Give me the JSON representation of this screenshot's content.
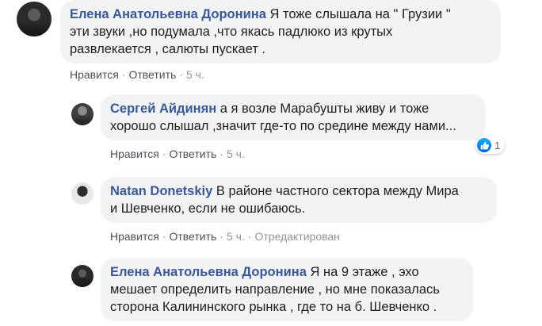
{
  "comments": [
    {
      "author": "Елена Анатольевна Доронина",
      "lines": [
        "Я тоже слышала на \" Грузии \"",
        "эти звуки ,но подумала ,что якась падлюко из крутых",
        "развлекается , салюты пускает ."
      ],
      "like_label": "Нравится",
      "reply_label": "Ответить",
      "time": "5 ч."
    },
    {
      "author": "Сергей Айдинян",
      "lines": [
        "а я возле Марабушты живу и тоже",
        "хорошо слышал ,значит где-то по средине между нами..."
      ],
      "like_label": "Нравится",
      "reply_label": "Ответить",
      "time": "5 ч.",
      "reaction_icon": "like-icon",
      "reaction_count": "1"
    },
    {
      "author": "Natan Donetskiy",
      "lines": [
        "В районе частного сектора между Мира",
        "и Шевченко, если не ошибаюсь."
      ],
      "like_label": "Нравится",
      "reply_label": "Ответить",
      "time": "5 ч.",
      "edited": "Отредактирован"
    },
    {
      "author": "Елена Анатольевна Доронина",
      "lines": [
        "Я на 9 этаже , эхо",
        "мешает определить направление , но мне показалась",
        "сторона Калининского рынка , где то на б. Шевченко ."
      ]
    }
  ],
  "colors": {
    "author": "#385898",
    "bubble": "#f2f3f5",
    "like": "#1877f2"
  }
}
